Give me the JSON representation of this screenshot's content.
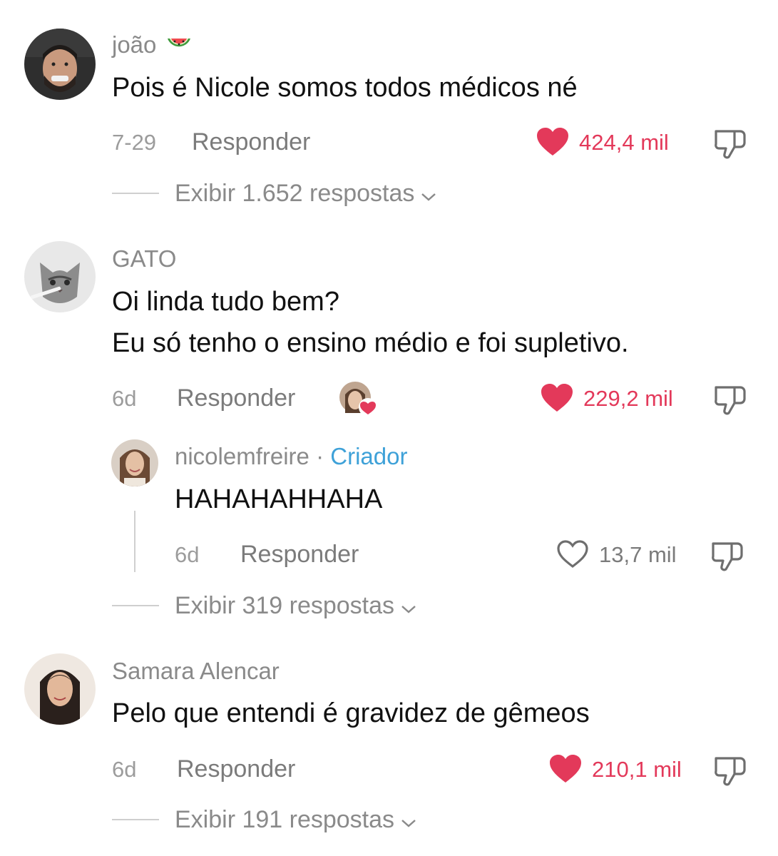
{
  "colors": {
    "like_red": "#e3395a",
    "creator_blue": "#3ea1d8",
    "muted": "#8a8a8a"
  },
  "comments": [
    {
      "username": "joão",
      "emoji": "🍉",
      "text": "Pois é Nicole somos todos médicos né",
      "date": "7-29",
      "reply_label": "Responder",
      "likes": "424,4 mil",
      "liked": true,
      "view_replies": "Exibir 1.652 respostas",
      "avatar": "man-avatar"
    },
    {
      "username": "GATO",
      "text_lines": [
        "Oi linda tudo bem?",
        "Eu só tenho o ensino médio e foi supletivo."
      ],
      "date": "6d",
      "reply_label": "Responder",
      "likes": "229,2 mil",
      "liked": true,
      "creator_liked_icon": "creator-heart-avatar",
      "avatar": "cat-avatar",
      "reply": {
        "username": "nicolemfreire",
        "separator": "·",
        "badge": "Criador",
        "text": "HAHAHAHHAHA",
        "date": "6d",
        "reply_label": "Responder",
        "likes": "13,7 mil",
        "liked": false,
        "avatar": "woman-avatar"
      },
      "view_replies": "Exibir 319 respostas"
    },
    {
      "username": "Samara Alencar",
      "text": "Pelo que entendi é gravidez de gêmeos",
      "date": "6d",
      "reply_label": "Responder",
      "likes": "210,1 mil",
      "liked": true,
      "view_replies": "Exibir 191 respostas",
      "avatar": "girl-avatar"
    }
  ]
}
